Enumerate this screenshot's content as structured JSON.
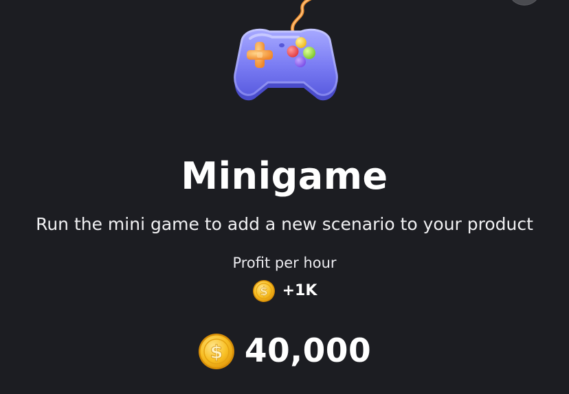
{
  "card": {
    "title": "Minigame",
    "description": "Run the mini game to add a new scenario to your product",
    "image_icon": "gamepad-icon"
  },
  "profit": {
    "label": "Profit per hour",
    "value": "+1K",
    "icon": "coin-icon"
  },
  "balance": {
    "value": "40,000",
    "icon": "coin-icon"
  },
  "close_icon": "close-icon",
  "colors": {
    "background": "#1c1d22",
    "text": "#ffffff",
    "controller_body": "#7b7df4",
    "coin_gold": "#f6b81b",
    "cable": "#f09a3c"
  }
}
